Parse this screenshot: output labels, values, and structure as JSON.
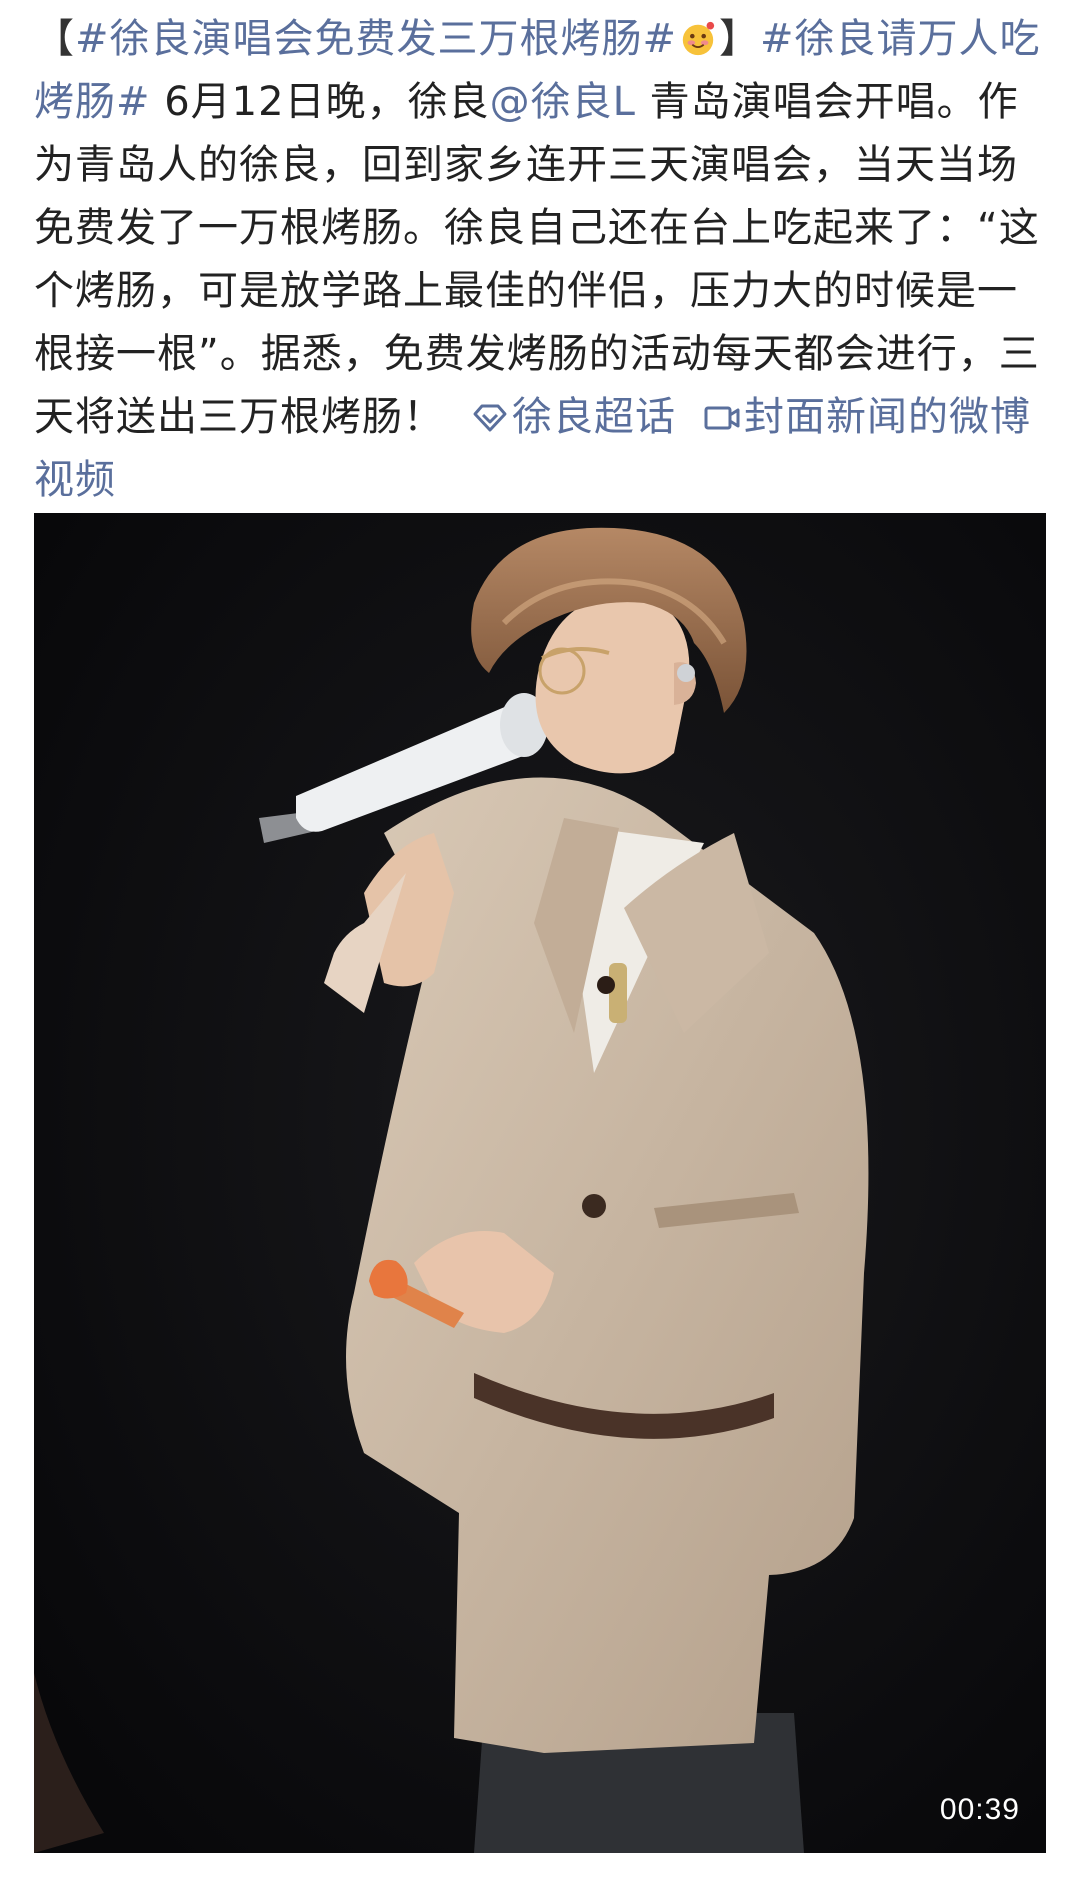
{
  "post": {
    "bracket_open": "【",
    "topic_1": "#徐良演唱会免费发三万根烤肠#",
    "bracket_close": "】",
    "topic_2": "#徐良请万人吃烤肠#",
    "text_1": " 6月12日晚，徐良",
    "mention": "@徐良L",
    "text_2": " 青岛演唱会开唱。作为青岛人的徐良，回到家乡连开三天演唱会，当天当场免费发了一万根烤肠。徐良自己还在台上吃起来了：“这个烤肠，可是放学路上最佳的伴侣，压力大的时候是一根接一根”。据悉，免费发烤肠的活动每天都会进行，三天将送出三万根烤肠！",
    "super_topic_link": "徐良超话",
    "video_link": "封面新闻的微博视频",
    "emoji": "smiling-face-emoji",
    "link_color": "#5a6f9c"
  },
  "video": {
    "duration": "00:39",
    "thumbnail": "singer-on-stage-with-microphone-and-sausage"
  }
}
